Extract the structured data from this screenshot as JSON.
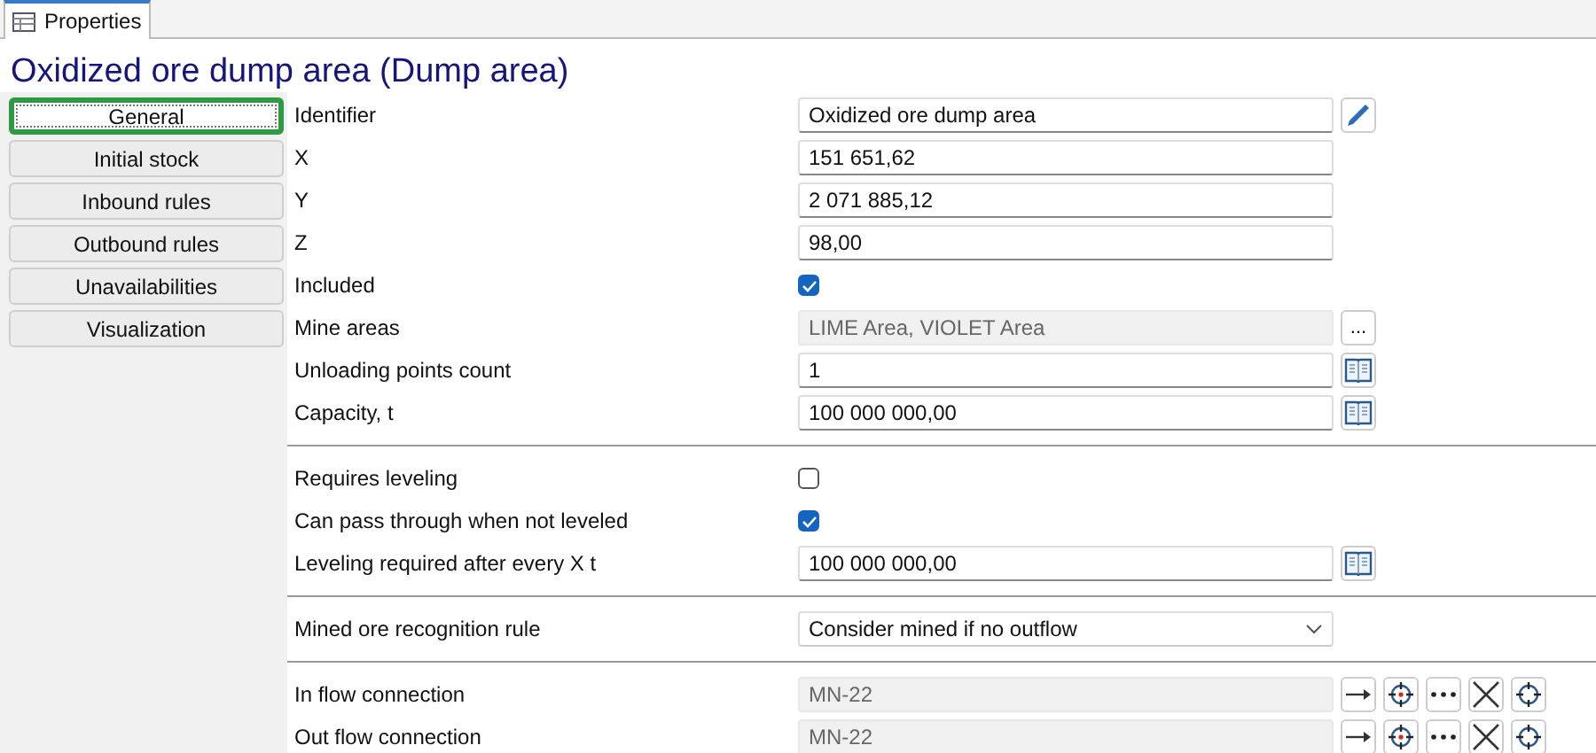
{
  "panel_tab": {
    "label": "Properties",
    "selected": true
  },
  "title": "Oxidized ore dump area (Dump area)",
  "nav": [
    {
      "label": "General",
      "selected": true
    },
    {
      "label": "Initial stock",
      "selected": false
    },
    {
      "label": "Inbound rules",
      "selected": false
    },
    {
      "label": "Outbound rules",
      "selected": false
    },
    {
      "label": "Unavailabilities",
      "selected": false
    },
    {
      "label": "Visualization",
      "selected": false
    }
  ],
  "sections": [
    {
      "rows": [
        {
          "kind": "text",
          "label": "Identifier",
          "value": "Oxidized ore dump area",
          "buttons": [
            {
              "kind": "pencil"
            }
          ]
        },
        {
          "kind": "text",
          "label": "X",
          "value": "151 651,62"
        },
        {
          "kind": "text",
          "label": "Y",
          "value": "2 071 885,12"
        },
        {
          "kind": "text",
          "label": "Z",
          "value": "98,00"
        },
        {
          "kind": "checkbox",
          "label": "Included",
          "checked": true
        },
        {
          "kind": "readonly",
          "label": "Mine areas",
          "value": "LIME Area, VIOLET Area",
          "buttons": [
            {
              "kind": "text",
              "text": "..."
            }
          ]
        },
        {
          "kind": "text",
          "label": "Unloading points count",
          "value": "1",
          "buttons": [
            {
              "kind": "book"
            }
          ]
        },
        {
          "kind": "text",
          "label": "Capacity, t",
          "value": "100 000 000,00",
          "buttons": [
            {
              "kind": "book"
            }
          ]
        }
      ]
    },
    {
      "rows": [
        {
          "kind": "checkbox",
          "label": "Requires leveling",
          "checked": false
        },
        {
          "kind": "checkbox",
          "label": "Can pass through when not leveled",
          "checked": true
        },
        {
          "kind": "text",
          "label": "Leveling required after every X t",
          "value": "100 000 000,00",
          "buttons": [
            {
              "kind": "book"
            }
          ]
        }
      ]
    },
    {
      "rows": [
        {
          "kind": "dropdown",
          "label": "Mined ore recognition rule",
          "value": "Consider mined if no outflow"
        }
      ]
    },
    {
      "rows": [
        {
          "kind": "readonly",
          "label": "In flow connection",
          "value": "MN-22",
          "buttons": [
            {
              "kind": "arrow"
            },
            {
              "kind": "target-red"
            },
            {
              "kind": "dots"
            },
            {
              "kind": "cross"
            },
            {
              "kind": "target"
            }
          ]
        },
        {
          "kind": "readonly",
          "label": "Out flow connection",
          "value": "MN-22",
          "buttons": [
            {
              "kind": "arrow"
            },
            {
              "kind": "target-red"
            },
            {
              "kind": "dots"
            },
            {
              "kind": "cross"
            },
            {
              "kind": "target"
            }
          ]
        }
      ]
    }
  ]
}
